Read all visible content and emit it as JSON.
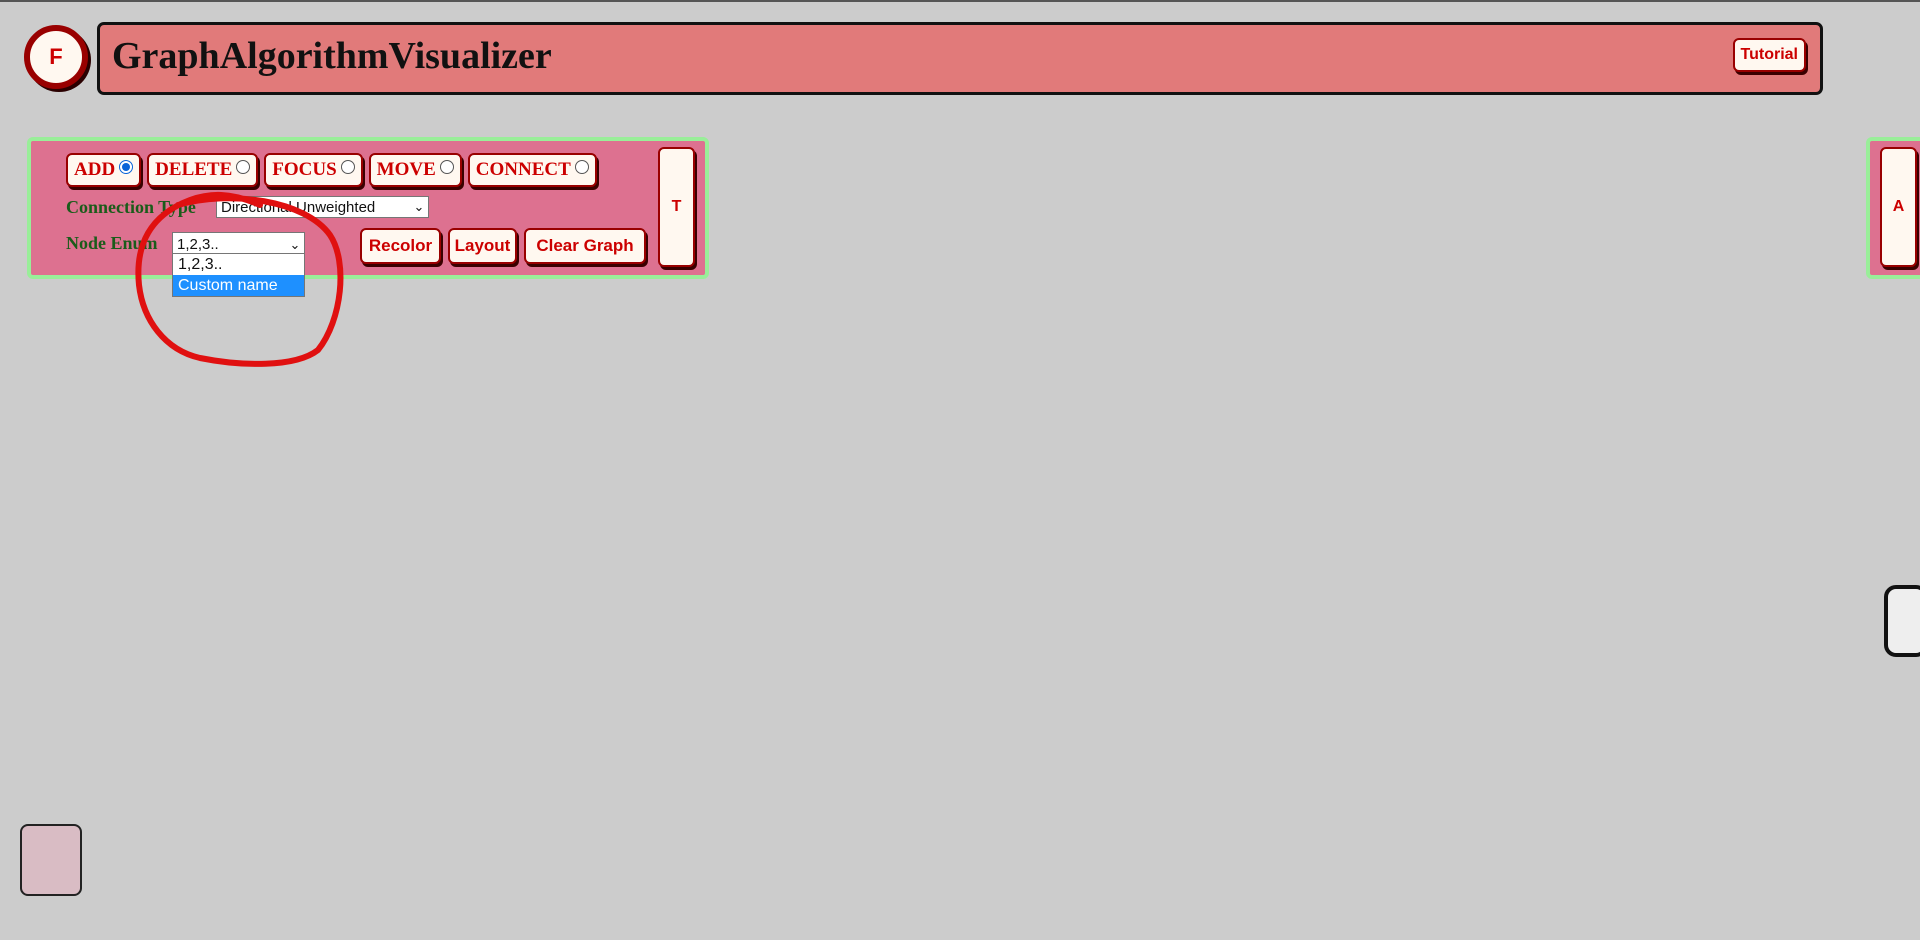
{
  "app": {
    "title": "GraphAlgorithmVisualizer",
    "favicon_letter": "F",
    "tutorial_label": "Tutorial"
  },
  "modes": [
    {
      "label": "ADD",
      "checked": true
    },
    {
      "label": "DELETE",
      "checked": false
    },
    {
      "label": "FOCUS",
      "checked": false
    },
    {
      "label": "MOVE",
      "checked": false
    },
    {
      "label": "CONNECT",
      "checked": false
    }
  ],
  "connection_type": {
    "label": "Connection Type",
    "value": "Directional Unweighted"
  },
  "node_enum": {
    "label": "Node Enum",
    "value": "1,2,3..",
    "options": [
      "1,2,3..",
      "Custom name"
    ],
    "highlighted_option": "Custom name"
  },
  "actions": {
    "recolor": "Recolor",
    "layout": "Layout",
    "clear_graph": "Clear Graph"
  },
  "side_toggle": "T",
  "right_panel_toggle": "A",
  "colors": {
    "background": "#cccccc",
    "header": "#e17a7a",
    "panel": "#dd7190",
    "panel_border": "#99ee99",
    "button_text": "#cc0000",
    "label_text": "#1a5c1a",
    "annotation_circle": "#e01010"
  }
}
